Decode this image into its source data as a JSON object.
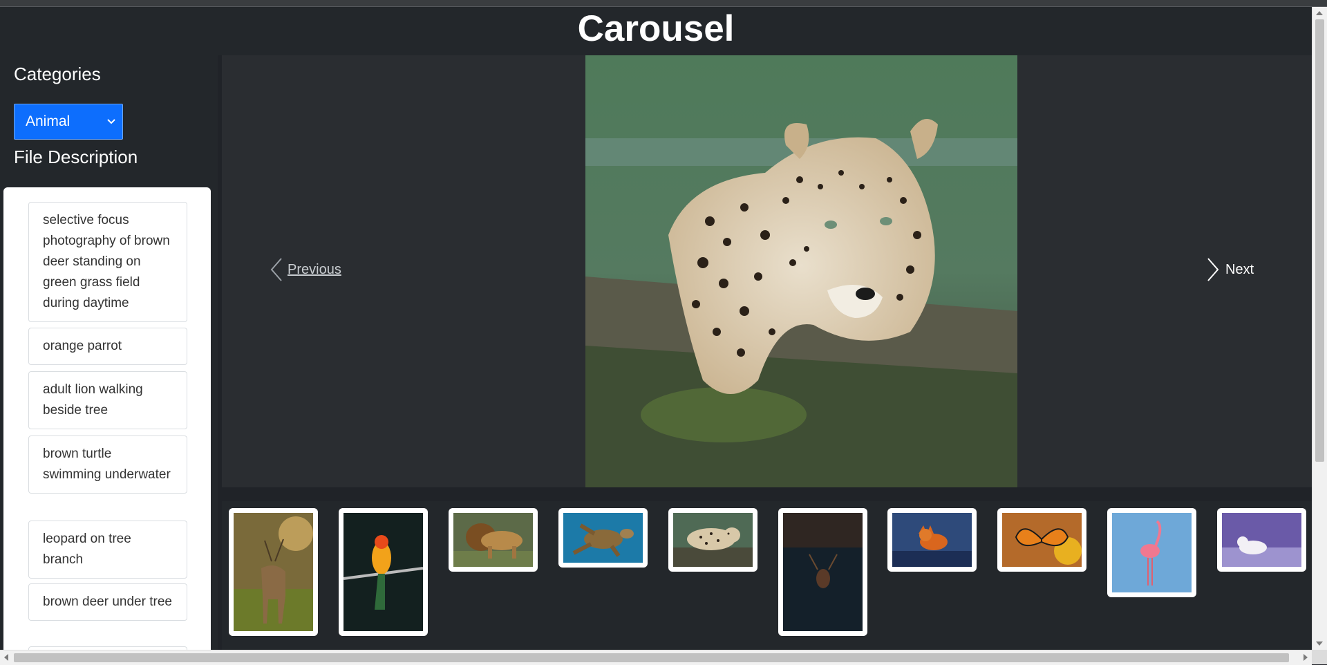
{
  "header": {
    "title": "Carousel"
  },
  "sidebar": {
    "categories_heading": "Categories",
    "category_select": {
      "selected": "Animal"
    },
    "description_heading": "File Description",
    "descriptions": [
      "selective focus photography of brown deer standing on green grass field during daytime",
      "orange parrot",
      "adult lion walking beside tree",
      "brown turtle swimming underwater",
      "leopard on tree branch",
      "brown deer under tree"
    ]
  },
  "carousel": {
    "previous_label": "Previous",
    "next_label": "Next",
    "current_image": "leopard-on-tree-branch"
  },
  "thumbnails": [
    {
      "name": "deer-in-field"
    },
    {
      "name": "orange-parrot"
    },
    {
      "name": "lion"
    },
    {
      "name": "sea-turtle"
    },
    {
      "name": "leopard"
    },
    {
      "name": "deer-in-dark-forest"
    },
    {
      "name": "red-fox"
    },
    {
      "name": "monarch-butterfly"
    },
    {
      "name": "flamingo"
    },
    {
      "name": "arctic-fox"
    }
  ],
  "colors": {
    "background": "#202328",
    "panel": "#23272b",
    "accent": "#0d6efd",
    "text": "#ffffff"
  }
}
